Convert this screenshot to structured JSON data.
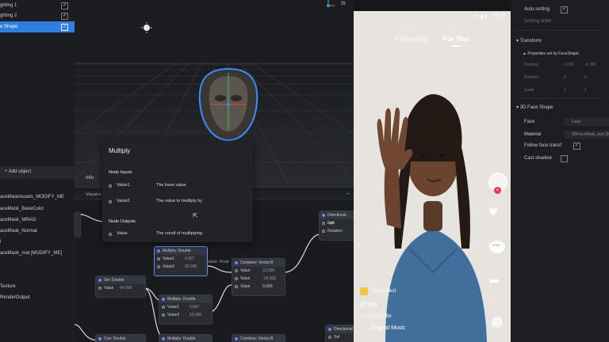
{
  "left_panel": {
    "items": [
      {
        "label": "ghting 1",
        "checked": true
      },
      {
        "label": "ghting 2",
        "checked": true
      },
      {
        "label": "e Shape",
        "checked": true
      }
    ],
    "add_object": "+ Add object",
    "assets": [
      "aceMaskAssets_MODIFY_ME",
      "aceMask_BaseColor",
      "aceMask_MRAO",
      "aceMask_Normal",
      "l",
      "aceMask_mat [MODIFY_ME]",
      "",
      "Texture",
      "RenderOutput"
    ]
  },
  "viewport": {
    "axis_label": "SI"
  },
  "graph": {
    "tab_info": "Info",
    "tab_visual": "Visual e",
    "nodes": {
      "multiply1": {
        "title": "Multiply: Double",
        "p1": "Value1",
        "v1": "0.567",
        "p2": "Value2",
        "v2": "50.000"
      },
      "multiply2": {
        "title": "Multiply: Double",
        "p1": "Value1",
        "v1": "0.567",
        "p2": "Value3",
        "v2": "50.000"
      },
      "multiply3": {
        "title": "Multiply: Double"
      },
      "sin": {
        "title": "Sin: Double",
        "p1": "Value",
        "v1": "54.000"
      },
      "cos": {
        "title": "Cos: Double"
      },
      "combine1": {
        "title": "Combine: Vector3f",
        "p1": "Value",
        "v1": "22.000",
        "p2": "Value",
        "v2": "-16.063",
        "p3": "Value",
        "v3": "0.000"
      },
      "combine2": {
        "title": "Combine: Vector3f"
      },
      "dir_light1": {
        "title": "Directional Ligh",
        "p1": "Set",
        "p2": "Rotation"
      },
      "dir_light2": {
        "title": "Directional",
        "p1": "Set"
      }
    },
    "partial_label": "value: Doub"
  },
  "tooltip": {
    "title": "Multiply",
    "inputs_header": "Node Inputs",
    "inputs": [
      {
        "name": "Value1",
        "desc": "The base value"
      },
      {
        "name": "Value2",
        "desc": "The value to multiply by"
      }
    ],
    "outputs_header": "Node Outputs",
    "outputs": [
      {
        "name": "Value",
        "desc": "The result of multiplying"
      }
    ]
  },
  "phone": {
    "time": "12:30",
    "tab_following": "Following",
    "tab_for_you": "For You",
    "effect_name": "Your Effect",
    "username": "@You",
    "hashtag": "#effectstudio",
    "music": "Original Music"
  },
  "right_panel": {
    "auto_sorting": "Auto sorting",
    "sorting_order": "Sorting order",
    "transform_header": "Transform",
    "transform_warning": "Properties set by FaceShape",
    "position": "Position",
    "rotation": "Rotation",
    "scale": "Scale",
    "position_vals": [
      "0.000",
      "-4.356"
    ],
    "rotation_vals": [
      "0",
      "0"
    ],
    "scale_vals": [
      "1",
      "1"
    ],
    "face_header": "3D Face Shape",
    "face_label": "Face",
    "face_value": "Face",
    "material_label": "Material",
    "material_value": "3DFaceMask_mat (M",
    "follow_label": "Follow face transf",
    "cast_shadow": "Cast shadow"
  },
  "colors": {
    "accent": "#2f7fe0",
    "node_header": "#343740",
    "selected_border": "#5b8dff",
    "tiktok_red": "#fe2c55"
  }
}
